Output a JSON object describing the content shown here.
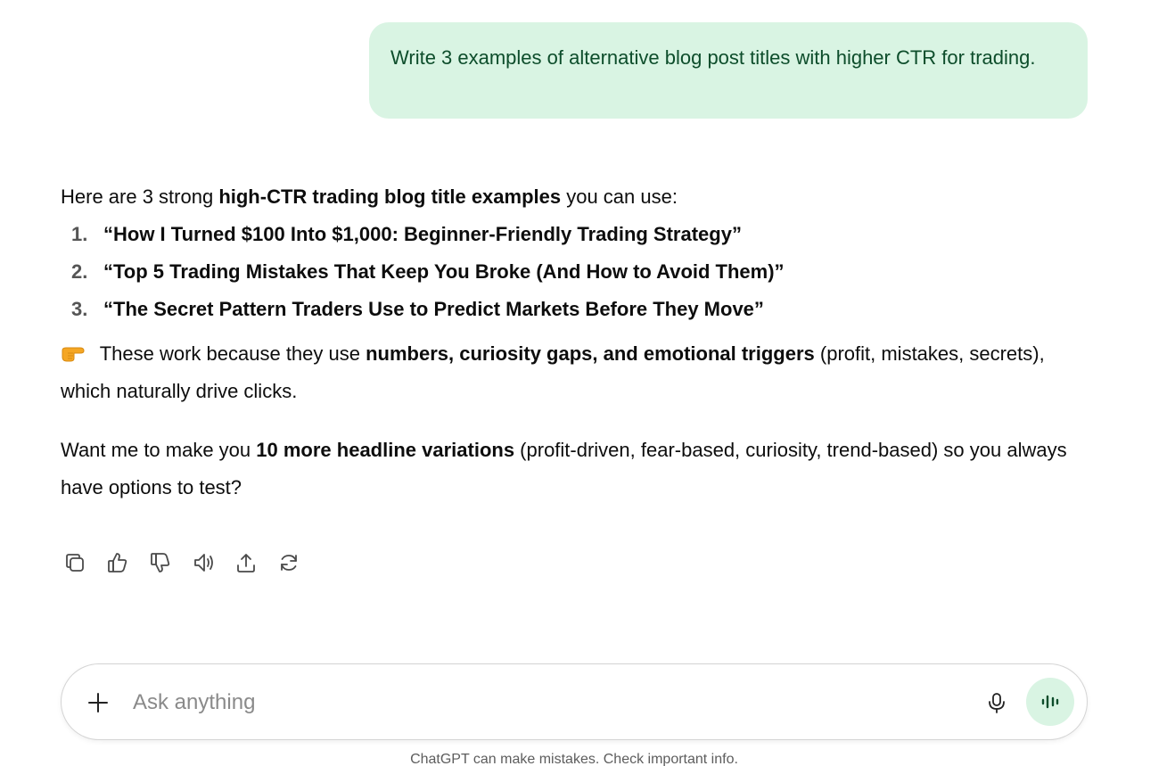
{
  "user_message": "Write 3 examples of alternative blog post titles with higher CTR for trading.",
  "assistant": {
    "intro_before": "Here are 3 strong ",
    "intro_bold": "high-CTR trading blog title examples",
    "intro_after": " you can use:",
    "titles": [
      {
        "num": "1.",
        "text": "“How I Turned $100 Into $1,000: Beginner-Friendly Trading Strategy”"
      },
      {
        "num": "2.",
        "text": "“Top 5 Trading Mistakes That Keep You Broke (And How to Avoid Them)”"
      },
      {
        "num": "3.",
        "text": "“The Secret Pattern Traders Use to Predict Markets Before They Move”"
      }
    ],
    "reason_emoji": "pointing-right-hand-emoji",
    "reason_before": " These work because they use ",
    "reason_bold": "numbers, curiosity gaps, and emotional triggers",
    "reason_after": " (profit, mistakes, secrets), which naturally drive clicks.",
    "offer_before": "Want me to make you ",
    "offer_bold": "10 more headline variations",
    "offer_after": " (profit-driven, fear-based, curiosity, trend-based) so you always have options to test?"
  },
  "actions": [
    "copy-icon",
    "thumbs-up-icon",
    "thumbs-down-icon",
    "read-aloud-icon",
    "share-icon",
    "regenerate-icon"
  ],
  "composer": {
    "placeholder": "Ask anything",
    "plus_icon": "plus-icon",
    "mic_icon": "microphone-icon",
    "voice_icon": "voice-mode-icon"
  },
  "footer": "ChatGPT can make mistakes. Check important info.",
  "colors": {
    "bubble_bg": "#d9f4e3",
    "bubble_text": "#0d4d2b",
    "voice_btn_bg": "#d9f4e3"
  }
}
